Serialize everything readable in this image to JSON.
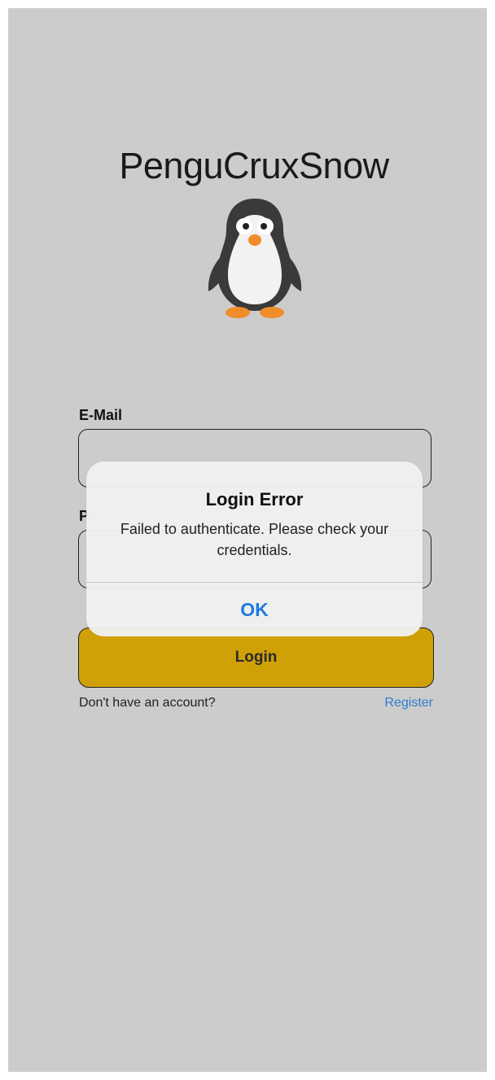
{
  "app": {
    "title": "PenguCruxSnow",
    "logo_icon": "penguin-icon"
  },
  "login_form": {
    "email_label": "E-Mail",
    "email_value": "",
    "password_label": "P",
    "password_value": "",
    "login_label": "Login",
    "no_account_text": "Don't have an account?",
    "register_label": "Register"
  },
  "alert": {
    "title": "Login Error",
    "message": "Failed to authenticate. Please check your credentials.",
    "ok_label": "OK"
  },
  "colors": {
    "background": "#cccccc",
    "login_button": "#cfa106",
    "link": "#2f7cd4",
    "alert_button": "#1f7ae0"
  }
}
